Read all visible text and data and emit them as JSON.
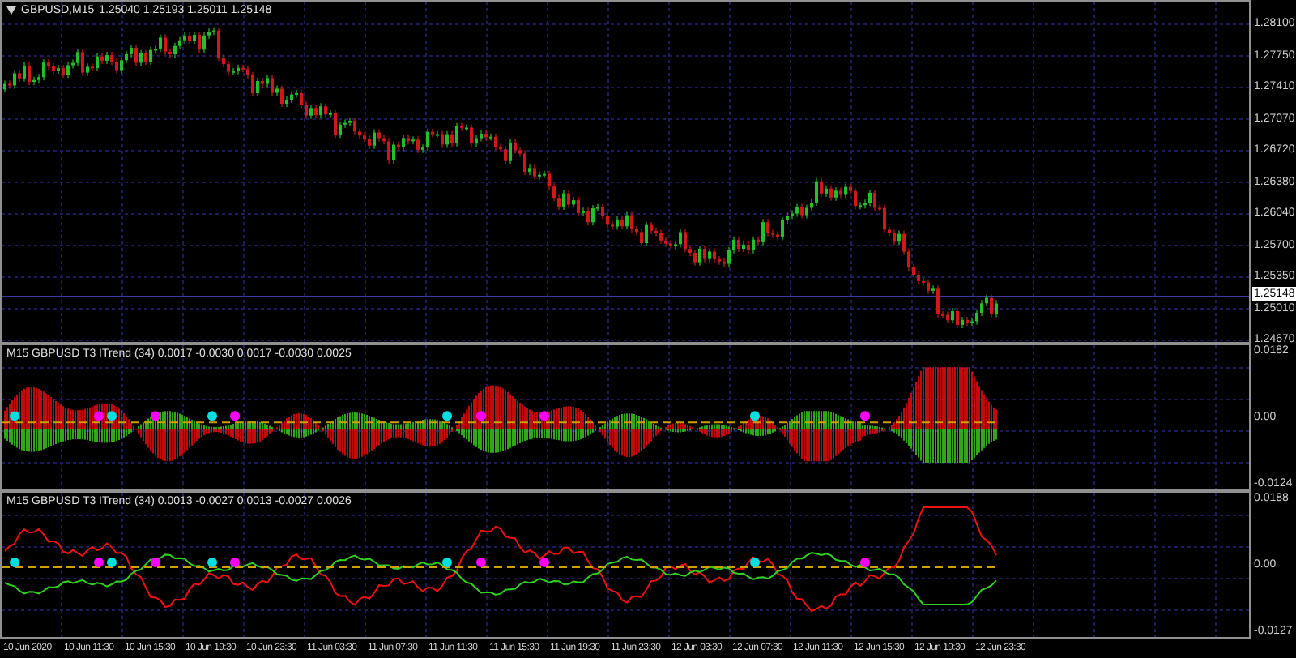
{
  "main_chart": {
    "symbol": "GBPUSD,M15",
    "ohlc": "1.25040 1.25193 1.25011 1.25148",
    "price_labels": [
      "1.28100",
      "1.27750",
      "1.27410",
      "1.27070",
      "1.26720",
      "1.26380",
      "1.26040",
      "1.25700",
      "1.25350",
      "1.25010",
      "1.24670"
    ],
    "current_price": "1.25148"
  },
  "indicators": [
    {
      "kind": "histogram",
      "title": "M15 GBPUSD T3 ITrend (34) 0.0017 -0.0030 0.0017 -0.0030 0.0025",
      "axis_labels": [
        "0.0182",
        "0.00",
        "-0.0124"
      ]
    },
    {
      "kind": "lines",
      "title": "M15 GBPUSD T3 ITrend (34) 0.0013 -0.0027 0.0013 -0.0027 0.0026",
      "axis_labels": [
        "0.0188",
        "0.00",
        "-0.0127"
      ]
    }
  ],
  "time_axis": [
    "10 Jun 2020",
    "10 Jun 11:30",
    "10 Jun 15:30",
    "10 Jun 19:30",
    "10 Jun 23:30",
    "11 Jun 03:30",
    "11 Jun 07:30",
    "11 Jun 11:30",
    "11 Jun 15:30",
    "11 Jun 19:30",
    "11 Jun 23:30",
    "12 Jun 03:30",
    "12 Jun 07:30",
    "12 Jun 11:30",
    "12 Jun 15:30",
    "12 Jun 19:30",
    "12 Jun 23:30"
  ]
}
